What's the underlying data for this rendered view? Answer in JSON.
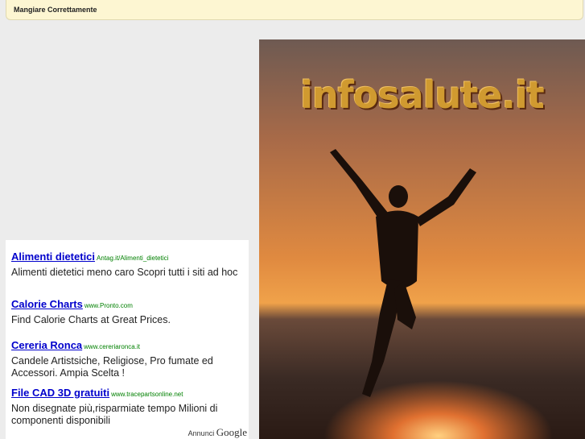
{
  "header": {
    "title": "Mangiare Correttamente"
  },
  "hero": {
    "logo_text": "infosalute.it"
  },
  "ads": [
    {
      "title": "Alimenti dietetici",
      "url": "Antag.it/Alimenti_dietetici",
      "desc": "Alimenti dietetici meno caro Scopri tutti i siti ad hoc"
    },
    {
      "title": "Calorie Charts",
      "url": "www.Pronto.com",
      "desc": "Find Calorie Charts at Great Prices."
    },
    {
      "title": "Cereria Ronca",
      "url": "www.cereriaronca.it",
      "desc": "Candele Artistsiche, Religiose, Pro fumate ed Accessori. Ampia Scelta !"
    },
    {
      "title": "File CAD 3D gratuiti",
      "url": "www.tracepartsonline.net",
      "desc": "Non disegnate più,risparmiate tempo Milioni di componenti disponibili"
    }
  ],
  "ads_footer": {
    "label": "Annunci",
    "brand": "Google"
  },
  "colors": {
    "link": "#0000cc",
    "url": "#008000",
    "topbar": "#fdf6d2"
  }
}
